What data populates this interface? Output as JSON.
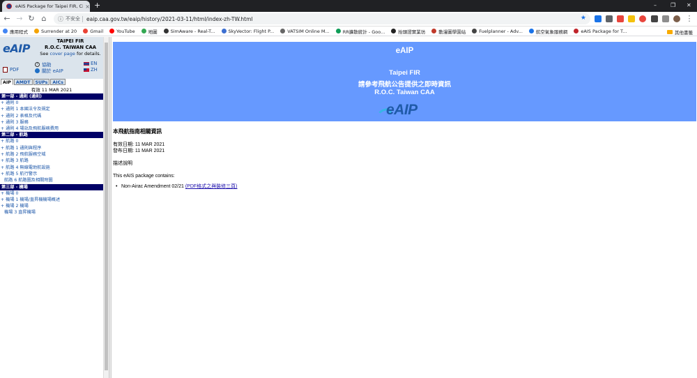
{
  "browser": {
    "tab_title": "eAIS Package for Taipei FIR, Ci",
    "tab_close": "×",
    "new_tab": "+",
    "security_label": "不安全",
    "url": "eaip.caa.gov.tw/eaip/history/2021-03-11/html/index-zh-TW.html",
    "window_min": "–",
    "window_max": "❐",
    "window_close": "✕"
  },
  "bookmarks": {
    "items": [
      {
        "label": "應用程式",
        "color": "#4285f4"
      },
      {
        "label": "Surrender at 20",
        "color": "#f4a300"
      },
      {
        "label": "Gmail",
        "color": "#ea4335"
      },
      {
        "label": "YouTube",
        "color": "#ff0000"
      },
      {
        "label": "地圖",
        "color": "#34a853"
      },
      {
        "label": "SimAware - Real-T...",
        "color": "#333333"
      },
      {
        "label": "SkyVector: Flight P...",
        "color": "#3c6fd1"
      },
      {
        "label": "VATSIM Online M...",
        "color": "#666666"
      },
      {
        "label": "RR擴散統計 - Goo...",
        "color": "#0f9d58"
      },
      {
        "label": "抬頭證實業坊",
        "color": "#222222"
      },
      {
        "label": "動漫圖學園站",
        "color": "#c0392b"
      },
      {
        "label": "Fuelplanner - Adv...",
        "color": "#444444"
      },
      {
        "label": "航空氣象服務網",
        "color": "#1a73e8"
      },
      {
        "label": "eAIS Package for T...",
        "color": "#c0242b"
      }
    ],
    "other_label": "其他書籤"
  },
  "left": {
    "logo": "eAIP",
    "fir": "TAIPEI FIR",
    "caa": "R.O.C. TAIWAN CAA",
    "see": "See",
    "cover_link": "cover page",
    "for_details": "for details.",
    "pdf": "PDF",
    "help": "協助",
    "about": "關於 eAIP",
    "lang_en": "EN",
    "lang_zh": "ZH",
    "tabs": [
      "AIP",
      "AMDT",
      "SUPs",
      "AICs"
    ],
    "effective": "有效 11 MAR 2021",
    "toc": [
      {
        "type": "head",
        "label": "第一部 - 通則 (通則)"
      },
      {
        "type": "item",
        "label": "+ 通則 0"
      },
      {
        "type": "item",
        "label": "+ 通則 1 本國法令及規定"
      },
      {
        "type": "item",
        "label": "+ 通則 2 表格及代碼"
      },
      {
        "type": "item",
        "label": "+ 通則 3 服務"
      },
      {
        "type": "item",
        "label": "+ 通則 4 場站及飛航服務費用"
      },
      {
        "type": "head",
        "label": "第二部 - 航路"
      },
      {
        "type": "item",
        "label": "+ 航路 0"
      },
      {
        "type": "item",
        "label": "+ 航路 1 通則與程序"
      },
      {
        "type": "item",
        "label": "+ 航路 2 飛航服務空域"
      },
      {
        "type": "item",
        "label": "+ 航路 3 航路"
      },
      {
        "type": "item",
        "label": "+ 航路 4 無線電助航設施"
      },
      {
        "type": "item",
        "label": "+ 航路 5 航行警示"
      },
      {
        "type": "plain",
        "label": "航路 6 航路圖及相關附圖"
      },
      {
        "type": "head",
        "label": "第三部 - 機場"
      },
      {
        "type": "item",
        "label": "+ 機場 0"
      },
      {
        "type": "item",
        "label": "+ 機場 1 機場/直昇機機場概述"
      },
      {
        "type": "item",
        "label": "+ 機場 2 機場"
      },
      {
        "type": "plain",
        "label": "機場 3 直昇機場"
      }
    ]
  },
  "main": {
    "title": "eAIP",
    "line1": "Taipei FIR",
    "line2": "請參考飛航公告提供之即時資訊",
    "line3": "R.O.C. Taiwan CAA",
    "logo": "eAIP",
    "heading": "本飛航指南相關資訊",
    "effective_date": "有效日期: 11 MAR 2021",
    "publication_date": "發布日期: 11 MAR 2021",
    "description_label": "描述說明",
    "package_contains": "This eAIS package contains:",
    "amendment_text": "Non-Airac Amendment 02/21",
    "amendment_link": "(PDF格式之與裝修三頁)"
  }
}
